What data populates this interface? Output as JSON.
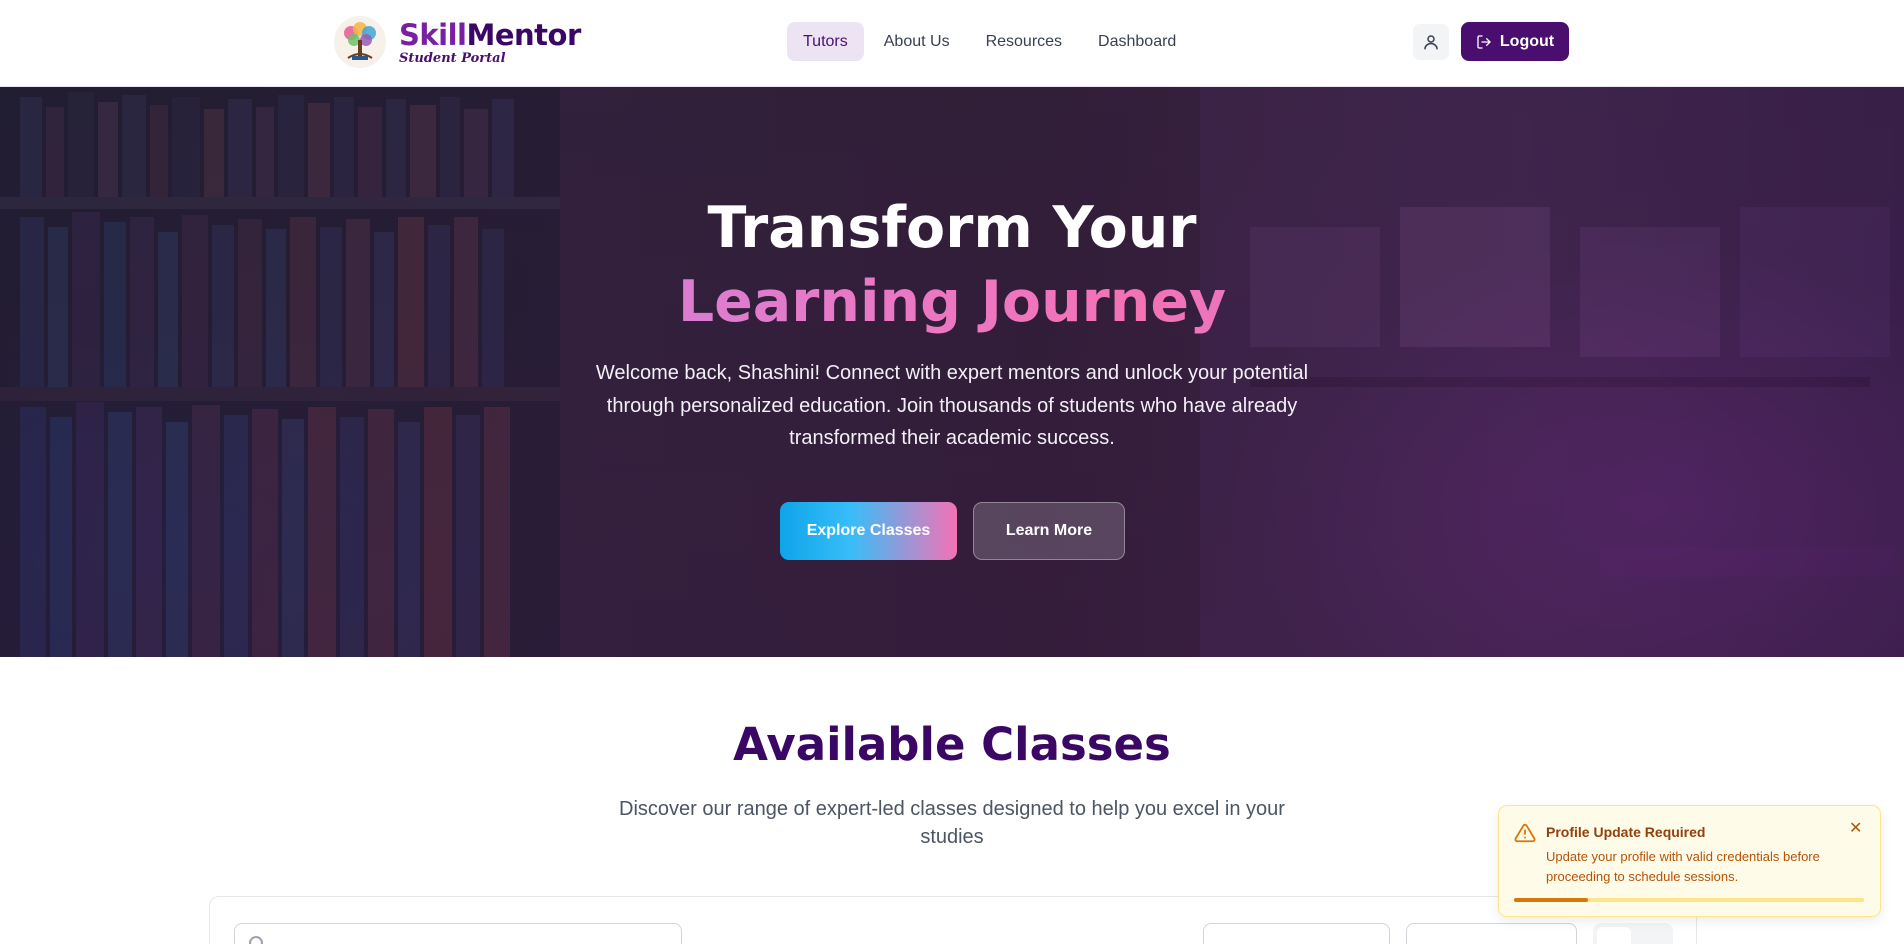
{
  "brand": {
    "name_part1": "Skill",
    "name_part2": "Mentor",
    "subtitle": "Student Portal",
    "logo_icon": "tree-logo-icon"
  },
  "nav": {
    "items": [
      {
        "label": "Tutors",
        "active": true
      },
      {
        "label": "About Us",
        "active": false
      },
      {
        "label": "Resources",
        "active": false
      },
      {
        "label": "Dashboard",
        "active": false
      }
    ]
  },
  "header_actions": {
    "user_icon": "user-icon",
    "logout_label": "Logout",
    "logout_icon": "logout-icon"
  },
  "hero": {
    "title_line1": "Transform Your",
    "title_line2": "Learning Journey",
    "description": "Welcome back, Shashini! Connect with expert mentors and unlock your potential through personalized education. Join thousands of students who have already transformed their academic success.",
    "primary_button": "Explore Classes",
    "secondary_button": "Learn More"
  },
  "classes_section": {
    "title": "Available Classes",
    "subtitle": "Discover our range of expert-led classes designed to help you excel in your studies"
  },
  "toast": {
    "title": "Profile Update Required",
    "message": "Update your profile with valid credentials before proceeding to schedule sessions.",
    "progress": 0.21,
    "icon": "warning-icon",
    "close_icon": "close-icon"
  },
  "colors": {
    "brand_primary": "#4a0f6e",
    "nav_active_bg": "#ede4f3",
    "toast_bg": "#fefbe8",
    "toast_accent": "#d97706"
  }
}
